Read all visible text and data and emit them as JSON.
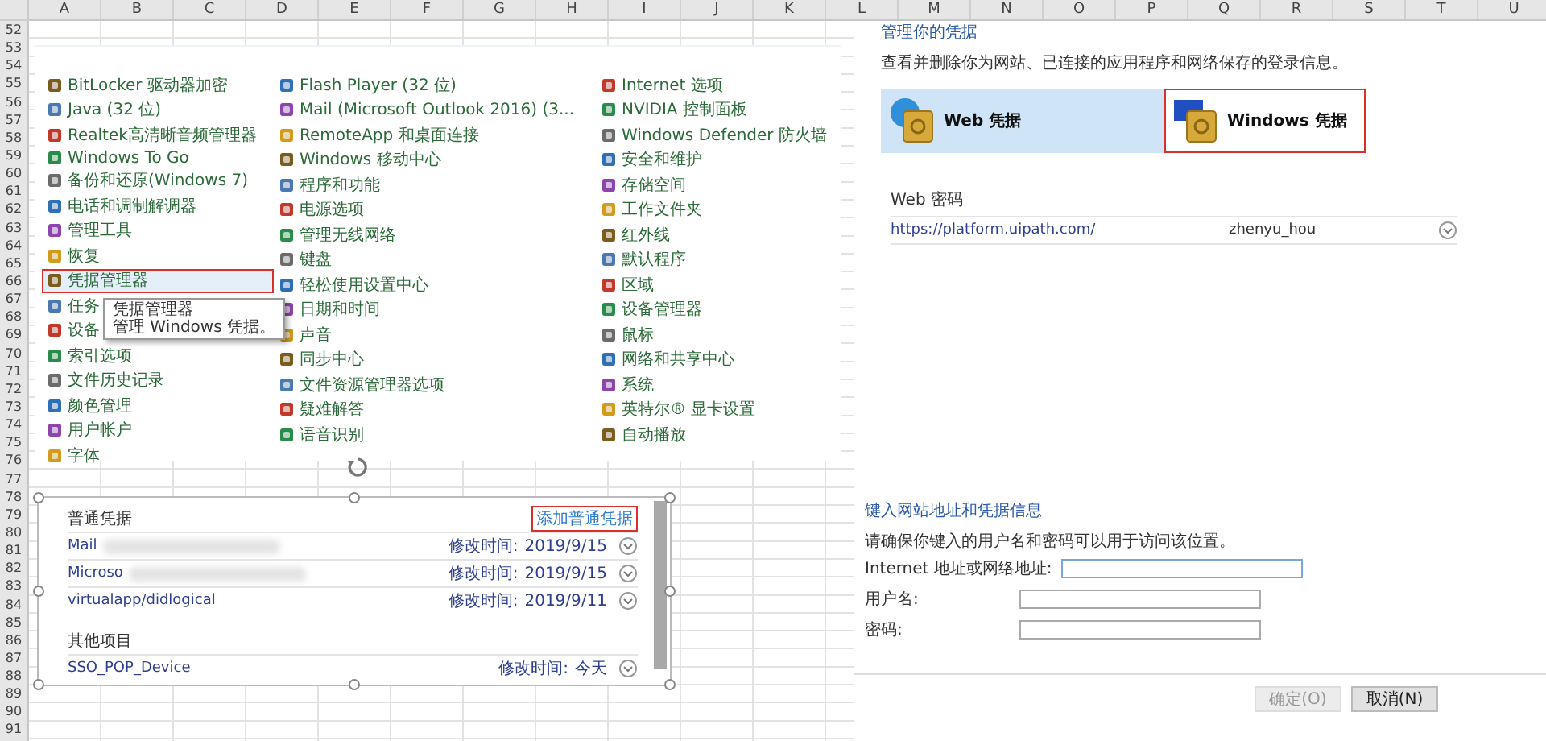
{
  "sheet": {
    "columns": [
      "A",
      "B",
      "C",
      "D",
      "E",
      "F",
      "G",
      "H",
      "I",
      "J",
      "K",
      "L",
      "M",
      "N",
      "O",
      "P",
      "Q",
      "R",
      "S",
      "T",
      "U"
    ],
    "rows": [
      "52",
      "53",
      "54",
      "55",
      "56",
      "57",
      "58",
      "59",
      "60",
      "61",
      "62",
      "63",
      "64",
      "65",
      "66",
      "67",
      "68",
      "69",
      "70",
      "71",
      "72",
      "73",
      "74",
      "75",
      "76",
      "77",
      "78",
      "79",
      "80",
      "81",
      "82",
      "83",
      "84",
      "85",
      "86",
      "87",
      "88",
      "89",
      "90",
      "91"
    ]
  },
  "control_panel": {
    "columns": [
      [
        {
          "label": "BitLocker 驱动器加密",
          "selected": false,
          "highlighted": false
        },
        {
          "label": "Java (32 位)",
          "selected": false,
          "highlighted": false
        },
        {
          "label": "Realtek高清晰音频管理器",
          "selected": false,
          "highlighted": false
        },
        {
          "label": "Windows To Go",
          "selected": false,
          "highlighted": false
        },
        {
          "label": "备份和还原(Windows 7)",
          "selected": false,
          "highlighted": false
        },
        {
          "label": "电话和调制解调器",
          "selected": false,
          "highlighted": false
        },
        {
          "label": "管理工具",
          "selected": false,
          "highlighted": false
        },
        {
          "label": "恢复",
          "selected": false,
          "highlighted": false
        },
        {
          "label": "凭据管理器",
          "selected": true,
          "highlighted": true
        },
        {
          "label": "任务",
          "selected": false,
          "highlighted": false
        },
        {
          "label": "设备",
          "selected": false,
          "highlighted": false
        },
        {
          "label": "索引选项",
          "selected": false,
          "highlighted": false
        },
        {
          "label": "文件历史记录",
          "selected": false,
          "highlighted": false
        },
        {
          "label": "颜色管理",
          "selected": false,
          "highlighted": false
        },
        {
          "label": "用户帐户",
          "selected": false,
          "highlighted": false
        },
        {
          "label": "字体",
          "selected": false,
          "highlighted": false
        }
      ],
      [
        {
          "label": "Flash Player (32 位)",
          "selected": false,
          "highlighted": false
        },
        {
          "label": "Mail (Microsoft Outlook 2016) (3...",
          "selected": false,
          "highlighted": false
        },
        {
          "label": "RemoteApp 和桌面连接",
          "selected": false,
          "highlighted": false
        },
        {
          "label": "Windows 移动中心",
          "selected": false,
          "highlighted": false
        },
        {
          "label": "程序和功能",
          "selected": false,
          "highlighted": false
        },
        {
          "label": "电源选项",
          "selected": false,
          "highlighted": false
        },
        {
          "label": "管理无线网络",
          "selected": false,
          "highlighted": false
        },
        {
          "label": "键盘",
          "selected": false,
          "highlighted": false
        },
        {
          "label": "轻松使用设置中心",
          "selected": false,
          "highlighted": false
        },
        {
          "label": "日期和时间",
          "selected": false,
          "highlighted": false
        },
        {
          "label": "声音",
          "selected": false,
          "highlighted": false
        },
        {
          "label": "同步中心",
          "selected": false,
          "highlighted": false
        },
        {
          "label": "文件资源管理器选项",
          "selected": false,
          "highlighted": false
        },
        {
          "label": "疑难解答",
          "selected": false,
          "highlighted": false
        },
        {
          "label": "语音识别",
          "selected": false,
          "highlighted": false
        }
      ],
      [
        {
          "label": "Internet 选项",
          "selected": false,
          "highlighted": false
        },
        {
          "label": "NVIDIA 控制面板",
          "selected": false,
          "highlighted": false
        },
        {
          "label": "Windows Defender 防火墙",
          "selected": false,
          "highlighted": false
        },
        {
          "label": "安全和维护",
          "selected": false,
          "highlighted": false
        },
        {
          "label": "存储空间",
          "selected": false,
          "highlighted": false
        },
        {
          "label": "工作文件夹",
          "selected": false,
          "highlighted": false
        },
        {
          "label": "红外线",
          "selected": false,
          "highlighted": false
        },
        {
          "label": "默认程序",
          "selected": false,
          "highlighted": false
        },
        {
          "label": "区域",
          "selected": false,
          "highlighted": false
        },
        {
          "label": "设备管理器",
          "selected": false,
          "highlighted": false
        },
        {
          "label": "鼠标",
          "selected": false,
          "highlighted": false
        },
        {
          "label": "网络和共享中心",
          "selected": false,
          "highlighted": false
        },
        {
          "label": "系统",
          "selected": false,
          "highlighted": false
        },
        {
          "label": "英特尔® 显卡设置",
          "selected": false,
          "highlighted": false
        },
        {
          "label": "自动播放",
          "selected": false,
          "highlighted": false
        }
      ]
    ],
    "tooltip": {
      "title": "凭据管理器",
      "text": "管理 Windows 凭据。"
    }
  },
  "credentials_panel": {
    "sections": [
      {
        "title": "普通凭据",
        "action": {
          "label": "添加普通凭据",
          "highlighted": true
        },
        "items": [
          {
            "name": "Mail",
            "blurred": true,
            "modified_label": "修改时间:",
            "modified": "2019/9/15"
          },
          {
            "name": "Microso",
            "blurred": true,
            "modified_label": "修改时间:",
            "modified": "2019/9/15"
          },
          {
            "name": "virtualapp/didlogical",
            "blurred": false,
            "modified_label": "修改时间:",
            "modified": "2019/9/11"
          }
        ]
      },
      {
        "title": "其他项目",
        "items": [
          {
            "name": "SSO_POP_Device",
            "blurred": false,
            "modified_label": "修改时间:",
            "modified": "今天"
          }
        ]
      }
    ]
  },
  "credential_manager": {
    "title": "管理你的凭据",
    "description": "查看并删除你为网站、已连接的应用程序和网络保存的登录信息。",
    "tiles": [
      {
        "label": "Web 凭据",
        "kind": "web",
        "selected": true,
        "highlighted": false
      },
      {
        "label": "Windows 凭据",
        "kind": "windows",
        "selected": false,
        "highlighted": true
      }
    ],
    "list_title": "Web 密码",
    "entries": [
      {
        "url": "https://platform.uipath.com/",
        "user": "zhenyu_hou"
      }
    ]
  },
  "add_form": {
    "title": "键入网站地址和凭据信息",
    "description": "请确保你键入的用户名和密码可以用于访问该位置。",
    "fields": [
      {
        "label": "Internet 地址或网络地址:",
        "focused": true
      },
      {
        "label": "用户名:",
        "focused": false
      },
      {
        "label": "密码:",
        "focused": false
      }
    ],
    "buttons": [
      {
        "label": "确定(O)",
        "disabled": true
      },
      {
        "label": "取消(N)",
        "disabled": false
      }
    ]
  }
}
